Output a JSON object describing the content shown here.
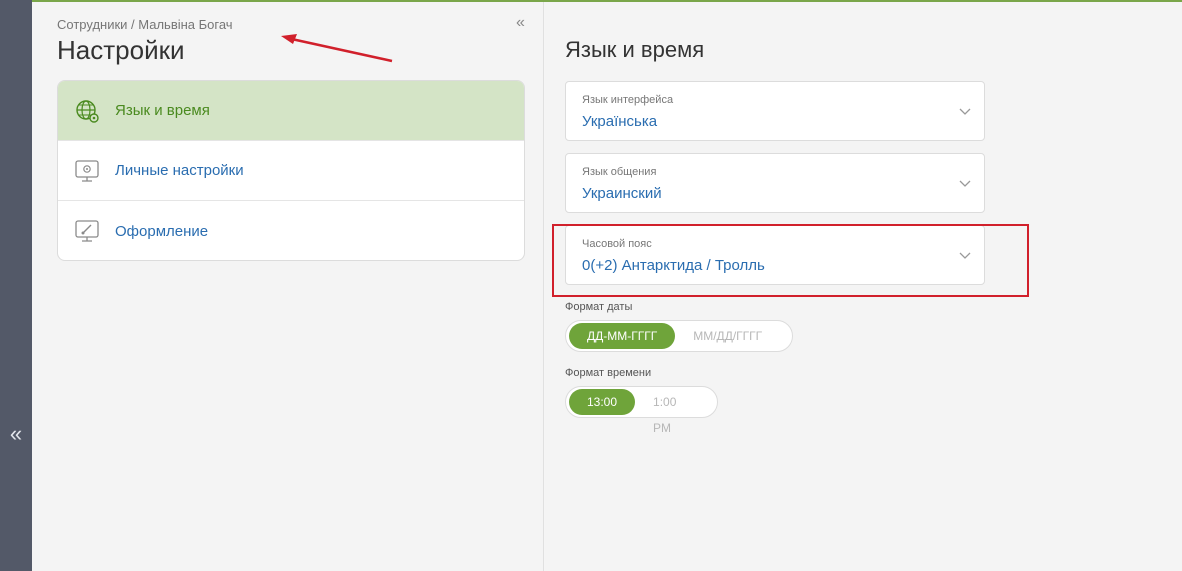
{
  "breadcrumb": "Сотрудники / Мальвіна Богач",
  "page_title": "Настройки",
  "collapse_glyph": "«",
  "rail_expand_glyph": "«",
  "menu": [
    {
      "label": "Язык и время",
      "icon": "globe-gear-icon",
      "active": true
    },
    {
      "label": "Личные настройки",
      "icon": "monitor-gear-icon",
      "active": false
    },
    {
      "label": "Оформление",
      "icon": "monitor-brush-icon",
      "active": false
    }
  ],
  "section": {
    "title": "Язык и время",
    "interface_language": {
      "label": "Язык интерфейса",
      "value": "Українська"
    },
    "communication_language": {
      "label": "Язык общения",
      "value": "Украинский"
    },
    "timezone": {
      "label": "Часовой пояс",
      "value": "0(+2) Антарктида / Тролль"
    },
    "date_format": {
      "label": "Формат даты",
      "options": [
        "ДД-ММ-ГГГГ",
        "ММ/ДД/ГГГГ"
      ],
      "selected": "ДД-ММ-ГГГГ"
    },
    "time_format": {
      "label": "Формат времени",
      "options": [
        "13:00",
        "1:00 PM"
      ],
      "selected": "13:00"
    }
  },
  "colors": {
    "accent_green": "#6fa43a",
    "link_blue": "#2a6db0",
    "annotation_red": "#d1202b",
    "rail": "#535968"
  }
}
